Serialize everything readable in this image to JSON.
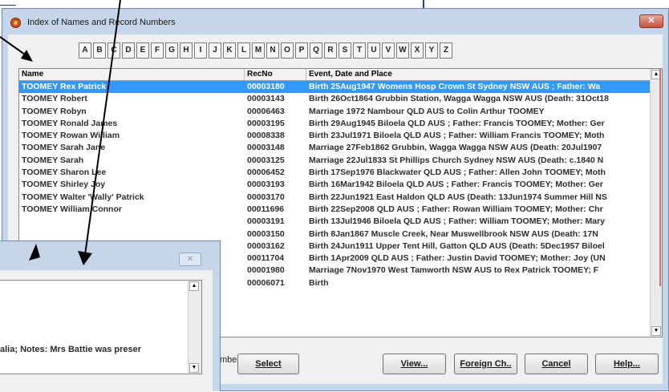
{
  "window": {
    "title": "Index of Names and Record Numbers",
    "close_label": "✕"
  },
  "alphabet": [
    "A",
    "B",
    "C",
    "D",
    "E",
    "F",
    "G",
    "H",
    "I",
    "J",
    "K",
    "L",
    "M",
    "N",
    "O",
    "P",
    "Q",
    "R",
    "S",
    "T",
    "U",
    "V",
    "W",
    "X",
    "Y",
    "Z"
  ],
  "list": {
    "columns": [
      "Name",
      "RecNo",
      "Event, Date and Place"
    ],
    "rows": [
      {
        "name": "TOOMEY Rex Patrick",
        "recno": "00003180",
        "event": "Birth 25Aug1947 Womens Hosp Crown St Sydney NSW AUS ; Father: Wa",
        "selected": true
      },
      {
        "name": "TOOMEY Robert",
        "recno": "00003143",
        "event": "Birth 26Oct1864 Grubbin Station, Wagga Wagga NSW AUS (Death: 31Oct18"
      },
      {
        "name": "TOOMEY Robyn",
        "recno": "00006463",
        "event": "Marriage 1972 Nambour QLD AUS  to Colin Arthur TOOMEY"
      },
      {
        "name": "TOOMEY Ronald James",
        "recno": "00003195",
        "event": "Birth 29Aug1945 Biloela QLD AUS ; Father: Francis TOOMEY; Mother: Ger"
      },
      {
        "name": "TOOMEY Rowan William",
        "recno": "00008338",
        "event": "Birth 23Jul1971 Biloela QLD AUS ; Father: William Francis TOOMEY; Moth"
      },
      {
        "name": "TOOMEY Sarah Jane",
        "recno": "00003148",
        "event": "Marriage 27Feb1862 Grubbin, Wagga Wagga NSW AUS (Death: 20Jul1907"
      },
      {
        "name": "TOOMEY Sarah",
        "recno": "00003125",
        "event": "Marriage 22Jul1833 St Phillips Church Sydney NSW AUS (Death: c.1840 N"
      },
      {
        "name": "TOOMEY Sharon Lee",
        "recno": "00006452",
        "event": "Birth 17Sep1976 Blackwater QLD AUS ; Father: Allen John TOOMEY; Moth"
      },
      {
        "name": "TOOMEY Shirley Joy",
        "recno": "00003193",
        "event": "Birth 16Mar1942 Biloela QLD AUS ; Father: Francis TOOMEY; Mother: Ger"
      },
      {
        "name": "TOOMEY Walter 'Wally' Patrick",
        "recno": "00003170",
        "event": "Birth 22Jun1921 East Haldon QLD AUS (Death: 13Jun1974 Summer Hill NS"
      },
      {
        "name": "TOOMEY William Connor",
        "recno": "00011696",
        "event": "Birth 22Sep2008 QLD AUS ; Father: Rowan William TOOMEY; Mother: Chr"
      },
      {
        "name": "",
        "recno": "00003191",
        "event": "Birth 13Jul1946 Biloela QLD AUS ; Father: William TOOMEY; Mother: Mary"
      },
      {
        "name": "",
        "recno": "00003150",
        "event": "Birth 8Jan1867 Muscle Creek, Near Muswellbrook NSW AUS (Death: 17N"
      },
      {
        "name": "",
        "recno": "00003162",
        "event": "Birth 24Jun1911 Upper Tent Hill, Gatton QLD AUS (Death: 5Dec1957 Biloel"
      },
      {
        "name": "",
        "recno": "00011704",
        "event": "Birth 1Apr2009 QLD AUS ; Father: Justin David TOOMEY; Mother: Joy (UN"
      },
      {
        "name": "",
        "recno": "00001980",
        "event": "Marriage 7Nov1970 West Tamworth NSW AUS  to Rex Patrick TOOMEY; F"
      },
      {
        "name": "",
        "recno": "00006071",
        "event": "Birth"
      }
    ]
  },
  "number_label": "mber",
  "buttons": {
    "select": "Select",
    "view": "View...",
    "foreign": "Foreign Ch..",
    "cancel": "Cancel",
    "help": "Help..."
  },
  "popup": {
    "close_label": "✕",
    "memo_text": "alia; Notes: Mrs Battie was preser"
  }
}
